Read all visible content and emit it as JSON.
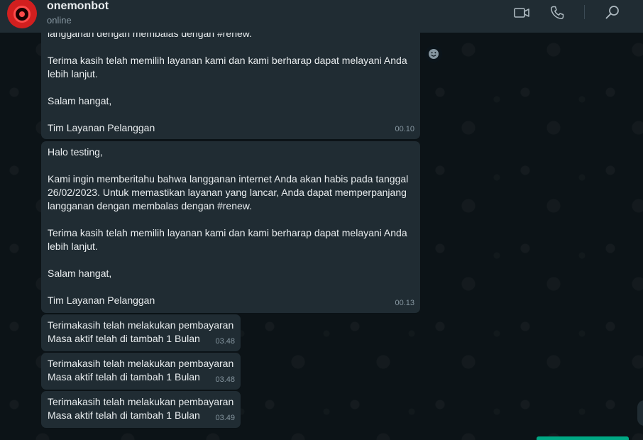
{
  "header": {
    "contact_name": "onemonbot",
    "status": "online",
    "icons": [
      "video-call-icon",
      "voice-call-icon",
      "search-icon"
    ]
  },
  "messages": [
    {
      "text": "langganan dengan membalas dengan #renew.\n\nTerima kasih telah memilih layanan kami dan kami berharap dapat melayani Anda lebih lanjut.\n\nSalam hangat,\n\nTim Layanan Pelanggan",
      "time": "00.10"
    },
    {
      "text": "Halo testing,\n\nKami ingin memberitahu bahwa langganan internet Anda akan habis pada tanggal 26/02/2023. Untuk memastikan layanan yang lancar, Anda dapat memperpanjang langganan dengan membalas dengan #renew.\n\nTerima kasih telah memilih layanan kami dan kami berharap dapat melayani Anda lebih lanjut.\n\nSalam hangat,\n\nTim Layanan Pelanggan",
      "time": "00.13"
    },
    {
      "text": "Terimakasih telah melakukan pembayaran\nMasa aktif telah di tambah 1 Bulan",
      "time": "03.48"
    },
    {
      "text": "Terimakasih telah melakukan pembayaran\nMasa aktif telah di tambah 1 Bulan",
      "time": "03.48"
    },
    {
      "text": "Terimakasih telah melakukan pembayaran\nMasa aktif telah di tambah 1 Bulan",
      "time": "03.49"
    }
  ],
  "colors": {
    "header_bg": "#202c33",
    "bubble_bg": "#202c33",
    "chat_bg": "#0b141a",
    "accent": "#00a884",
    "avatar": "#d21f1f"
  }
}
